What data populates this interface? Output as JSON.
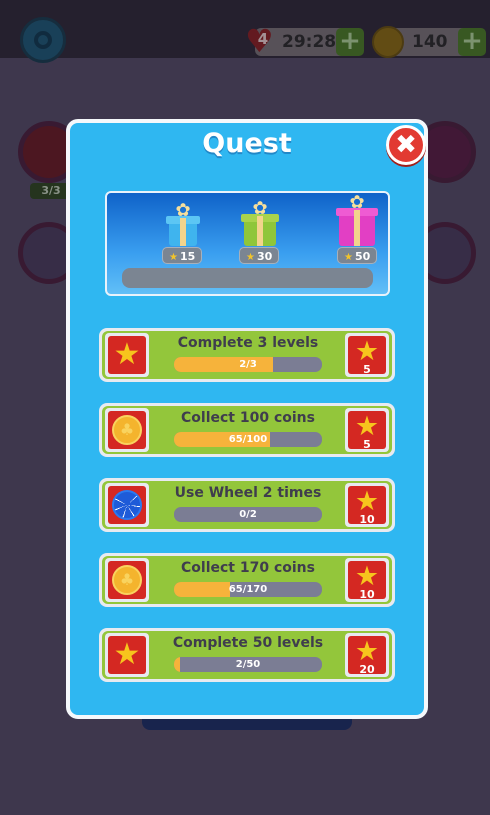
{
  "topbar": {
    "lives_count": "4",
    "lives_timer": "29:28",
    "coins": "140",
    "plus_label": "+"
  },
  "background": {
    "wheel_counter": "3/3"
  },
  "panel": {
    "title": "Quest",
    "close_label": "✖"
  },
  "chests": [
    {
      "stars": "15",
      "color": "#3fb4ee"
    },
    {
      "stars": "30",
      "color": "#8fc63a"
    },
    {
      "stars": "50",
      "color": "#e23fc4"
    }
  ],
  "chest_progress": 0,
  "quests": [
    {
      "title": "Complete 3 levels",
      "progress": "2/3",
      "fraction": 0.667,
      "reward": "5",
      "icon": "star-icon"
    },
    {
      "title": "Collect 100 coins",
      "progress": "65/100",
      "fraction": 0.65,
      "reward": "5",
      "icon": "coin-icon"
    },
    {
      "title": "Use Wheel 2 times",
      "progress": "0/2",
      "fraction": 0,
      "reward": "10",
      "icon": "wheel-icon"
    },
    {
      "title": "Collect 170 coins",
      "progress": "65/170",
      "fraction": 0.38,
      "reward": "10",
      "icon": "coin-icon"
    },
    {
      "title": "Complete 50 levels",
      "progress": "2/50",
      "fraction": 0.04,
      "reward": "20",
      "icon": "star-icon"
    }
  ]
}
